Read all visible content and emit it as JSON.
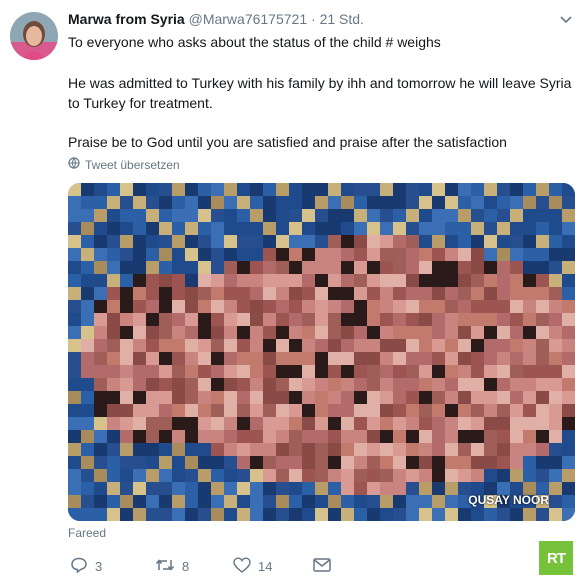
{
  "tweet": {
    "author_name": "Marwa from Syria",
    "handle": "@Marwa76175721",
    "separator": "·",
    "time": "21 Std.",
    "text_paragraph_1": "To everyone who asks about the status of the child # weighs",
    "text_paragraph_2": "He was admitted to Turkey with his family by ihh and tomorrow he will leave Syria to Turkey for treatment.",
    "text_paragraph_3": "Praise be to God until you are satisfied and praise after the satisfaction",
    "translate_label": "Tweet übersetzen",
    "media_credit_overlay": "QUSAY NOOR",
    "photo_credit": "Fareed"
  },
  "actions": {
    "reply_count": "3",
    "retweet_count": "8",
    "like_count": "14"
  },
  "watermark": {
    "text": "RT",
    "color": "#77c23b"
  },
  "icons": [
    "avatar",
    "chevron-down-icon",
    "globe-icon",
    "reply-icon",
    "retweet-icon",
    "like-icon",
    "message-icon"
  ]
}
